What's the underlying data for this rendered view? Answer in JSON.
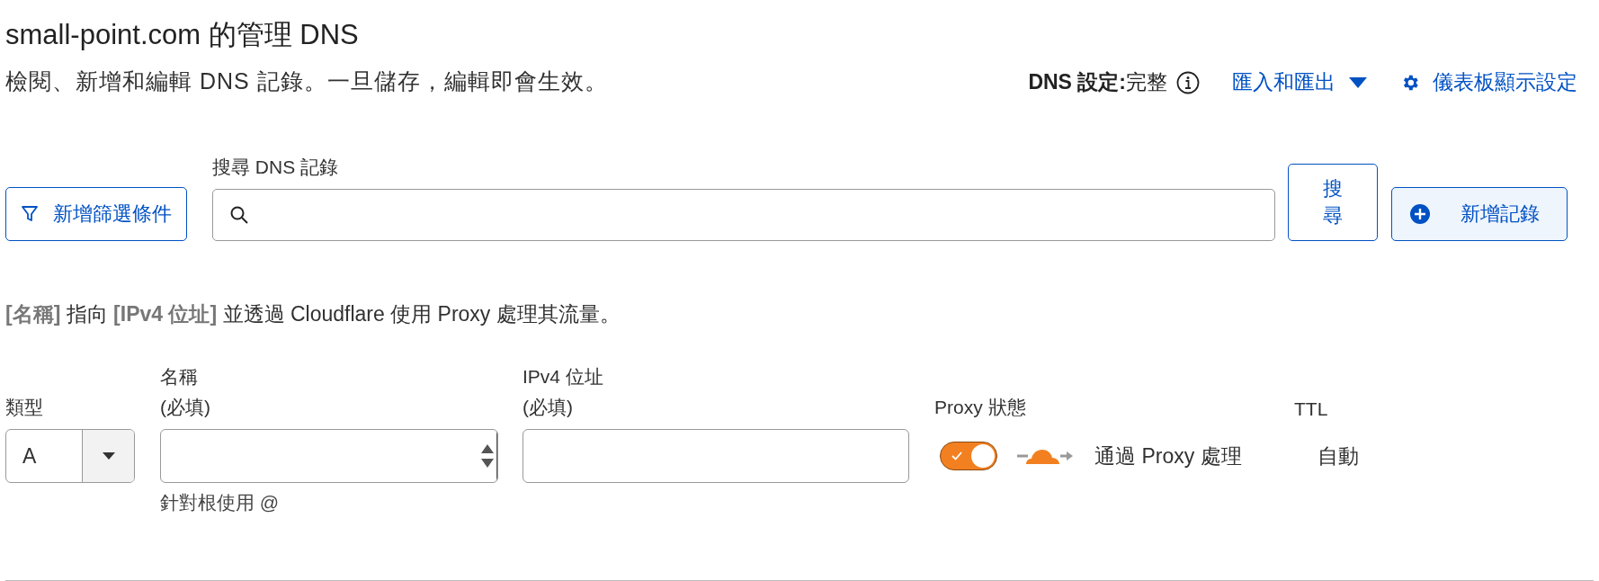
{
  "header": {
    "title": "small-point.com 的管理 DNS",
    "description": "檢閱、新增和編輯 DNS 記錄。一旦儲存，編輯即會生效。"
  },
  "actions": {
    "dns_setting_label": "DNS 設定:",
    "dns_setting_value": "完整",
    "import_export": "匯入和匯出",
    "dashboard_settings": "儀表板顯示設定"
  },
  "toolbar": {
    "filter_button": "新增篩選條件",
    "search_label": "搜尋 DNS 記錄",
    "search_button": "搜尋",
    "add_button": "新增記錄"
  },
  "summary": "**[名稱]** 指向 **[IPv4 位址]** 並透過 Cloudflare 使用 Proxy 處理其流量。",
  "form": {
    "type": {
      "label": "類型",
      "value": "A"
    },
    "name": {
      "label": "名稱",
      "required": "(必填)",
      "hint": "針對根使用 @"
    },
    "ipv4": {
      "label": "IPv4 位址",
      "required": "(必填)"
    },
    "proxy": {
      "label": "Proxy 狀態",
      "on": true,
      "status": "通過 Proxy 處理"
    },
    "ttl": {
      "label": "TTL",
      "value": "自動"
    }
  }
}
